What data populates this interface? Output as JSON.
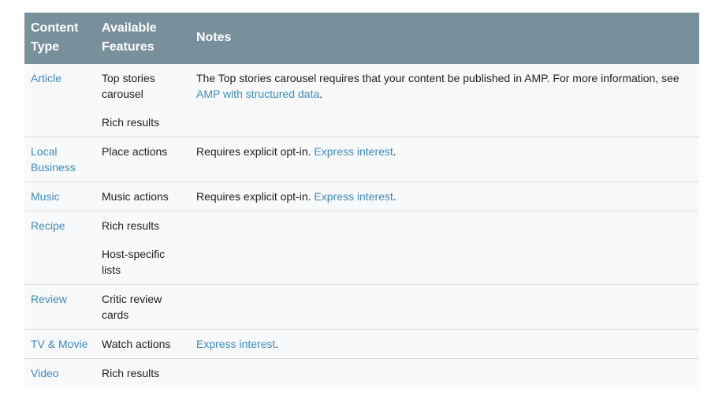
{
  "table": {
    "headers": {
      "content_type": "Content Type",
      "available_features": "Available Features",
      "notes": "Notes"
    },
    "rows": [
      {
        "content_type": "Article",
        "features": [
          "Top stories carousel",
          "Rich results"
        ],
        "notes_text": "The Top stories carousel requires that your content be published in AMP. For more information, see ",
        "notes_link": "AMP with structured data",
        "notes_suffix": "."
      },
      {
        "content_type": "Local Business",
        "features": [
          "Place actions"
        ],
        "notes_text": "Requires explicit opt-in. ",
        "notes_link": "Express interest",
        "notes_suffix": "."
      },
      {
        "content_type": "Music",
        "features": [
          "Music actions"
        ],
        "notes_text": "Requires explicit opt-in. ",
        "notes_link": "Express interest",
        "notes_suffix": "."
      },
      {
        "content_type": "Recipe",
        "features": [
          "Rich results",
          "Host-specific lists"
        ],
        "notes_text": "",
        "notes_link": "",
        "notes_suffix": ""
      },
      {
        "content_type": "Review",
        "features": [
          "Critic review cards"
        ],
        "notes_text": "",
        "notes_link": "",
        "notes_suffix": ""
      },
      {
        "content_type": "TV & Movie",
        "features": [
          "Watch actions"
        ],
        "notes_text": "",
        "notes_link": "Express interest",
        "notes_suffix": "."
      },
      {
        "content_type": "Video",
        "features": [
          "Rich results"
        ],
        "notes_text": "",
        "notes_link": "",
        "notes_suffix": ""
      }
    ]
  },
  "colors": {
    "header_bg": "#78909c",
    "row_bg": "#f8f9fa",
    "link": "#3c8cc4"
  }
}
